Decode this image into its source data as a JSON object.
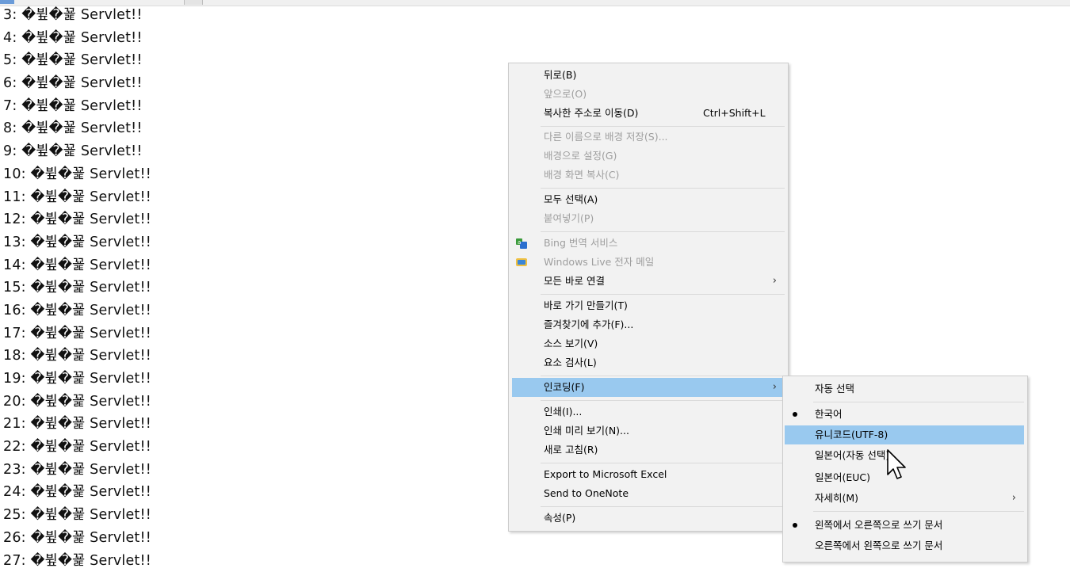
{
  "page": {
    "lines": [
      "3: �뷮�꾩 Servlet!!",
      "4: �뷮�꾩 Servlet!!",
      "5: �뷮�꾩 Servlet!!",
      "6: �뷮�꾩 Servlet!!",
      "7: �뷮�꾩 Servlet!!",
      "8: �뷮�꾩 Servlet!!",
      "9: �뷮�꾩 Servlet!!",
      "10: �뷮�꾩 Servlet!!",
      "11: �뷮�꾩 Servlet!!",
      "12: �뷮�꾩 Servlet!!",
      "13: �뷮�꾩 Servlet!!",
      "14: �뷮�꾩 Servlet!!",
      "15: �뷮�꾩 Servlet!!",
      "16: �뷮�꾩 Servlet!!",
      "17: �뷮�꾩 Servlet!!",
      "18: �뷮�꾩 Servlet!!",
      "19: �뷮�꾩 Servlet!!",
      "20: �뷮�꾩 Servlet!!",
      "21: �뷮�꾩 Servlet!!",
      "22: �뷮�꾩 Servlet!!",
      "23: �뷮�꾩 Servlet!!",
      "24: �뷮�꾩 Servlet!!",
      "25: �뷮�꾩 Servlet!!",
      "26: �뷮�꾩 Servlet!!",
      "27: �뷮�꾩 Servlet!!"
    ]
  },
  "context_menu": {
    "back": "뒤로(B)",
    "forward": "앞으로(O)",
    "go_copied": "복사한 주소로 이동(D)",
    "go_copied_shortcut": "Ctrl+Shift+L",
    "save_bg": "다른 이름으로 배경 저장(S)...",
    "set_bg": "배경으로 설정(G)",
    "copy_bg": "배경 화면 복사(C)",
    "select_all": "모두 선택(A)",
    "paste": "붙여넣기(P)",
    "bing": "Bing 번역 서비스",
    "windows_live": "Windows Live 전자 메일",
    "all_accelerators": "모든 바로 연결",
    "create_shortcut": "바로 가기 만들기(T)",
    "add_favorites": "즐겨찾기에 추가(F)...",
    "view_source": "소스 보기(V)",
    "inspect": "요소 검사(L)",
    "encoding": "인코딩(F)",
    "print": "인쇄(I)...",
    "print_preview": "인쇄 미리 보기(N)...",
    "refresh": "새로 고침(R)",
    "export_excel": "Export to Microsoft Excel",
    "send_onenote": "Send to OneNote",
    "properties": "속성(P)"
  },
  "encoding_menu": {
    "auto": "자동 선택",
    "korean": "한국어",
    "utf8": "유니코드(UTF-8)",
    "japanese_auto": "일본어(자동 선택)",
    "japanese_euc": "일본어(EUC)",
    "more": "자세히(M)",
    "ltr": "왼쪽에서 오른쪽으로 쓰기 문서",
    "rtl": "오른쪽에서 왼쪽으로 쓰기 문서"
  },
  "colors": {
    "menu_bg": "#f2f2f2",
    "highlight": "#99c9ef",
    "disabled_text": "#9e9e9e"
  },
  "icons": {
    "bing": "bing-translate-icon",
    "windows_live": "windows-live-mail-icon",
    "submenu": "chevron-right-icon",
    "cursor": "mouse-pointer-icon"
  }
}
